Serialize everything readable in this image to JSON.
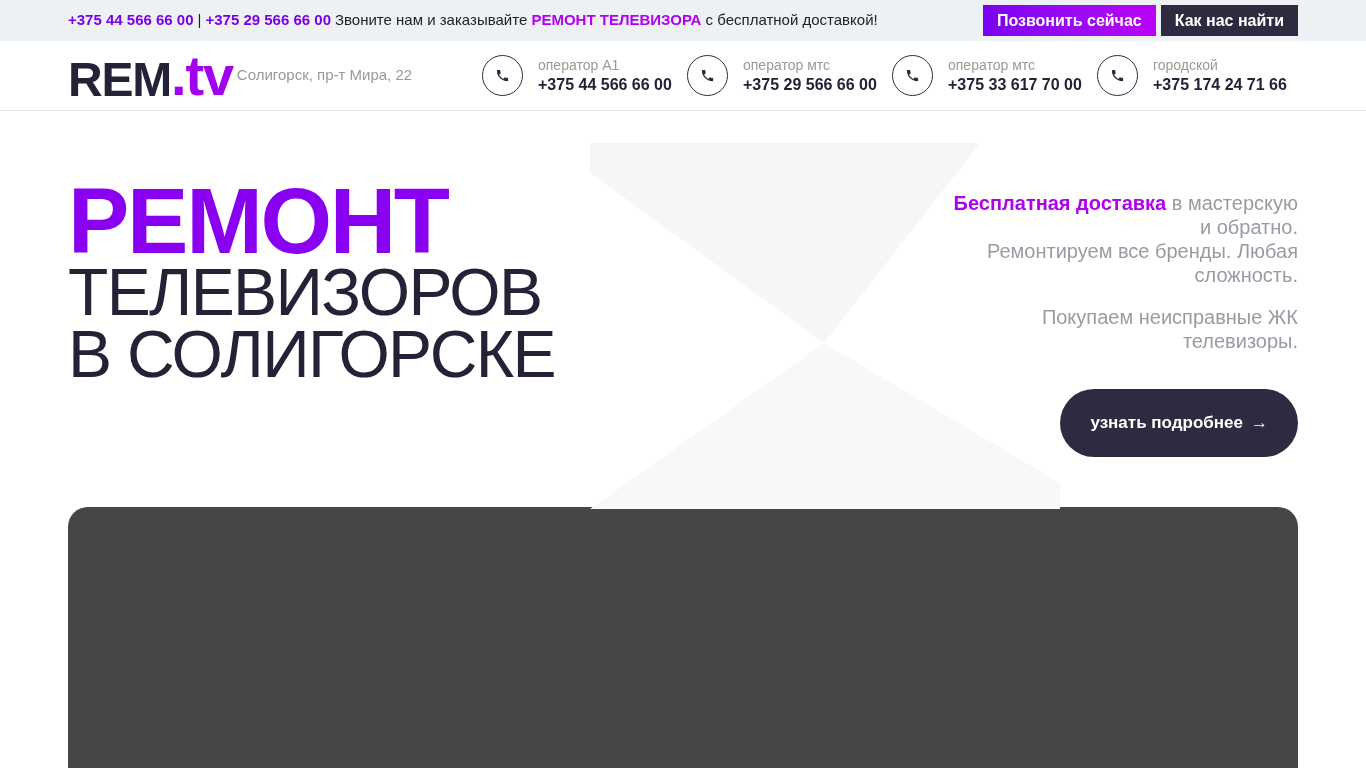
{
  "top_bar": {
    "phones": [
      "+375 44 566 66 00",
      "+375 29 566 66 00"
    ],
    "separator": "|",
    "message": "Звоните нам и заказывайте **РЕМОНТ ТЕЛЕВИЗОРА** с бесплатной доставкой!",
    "buttons": [
      {
        "label": "Позвонить сейчас",
        "kind": "primary"
      },
      {
        "label": "Как нас найти",
        "kind": "dark"
      }
    ]
  },
  "header": {
    "logo": {
      "main": "REM",
      "accent": ".tv"
    },
    "address": "Солигорск, пр-т Мира, 22",
    "contacts": [
      {
        "label": "оператор А1",
        "phone": "+375 44 566 66 00"
      },
      {
        "label": "оператор мтс",
        "phone": "+375 29 566 66 00"
      },
      {
        "label": "оператор мтс",
        "phone": "+375 33 617 70 00"
      },
      {
        "label": "городской",
        "phone": "+375 174 24 71 66"
      }
    ]
  },
  "hero": {
    "title": [
      "РЕМОНТ",
      "ТЕЛЕВИЗОРОВ",
      "В СОЛИГОРСКЕ"
    ],
    "paragraphs": [
      [
        "**Бесплатная доставка** в мастерскую и обратно.",
        "Ремонтируем все бренды. Любая сложность."
      ],
      [
        "Покупаем неисправные ЖК телевизоры."
      ]
    ],
    "button": {
      "label": "узнать подробнее",
      "arrow": "→"
    }
  }
}
